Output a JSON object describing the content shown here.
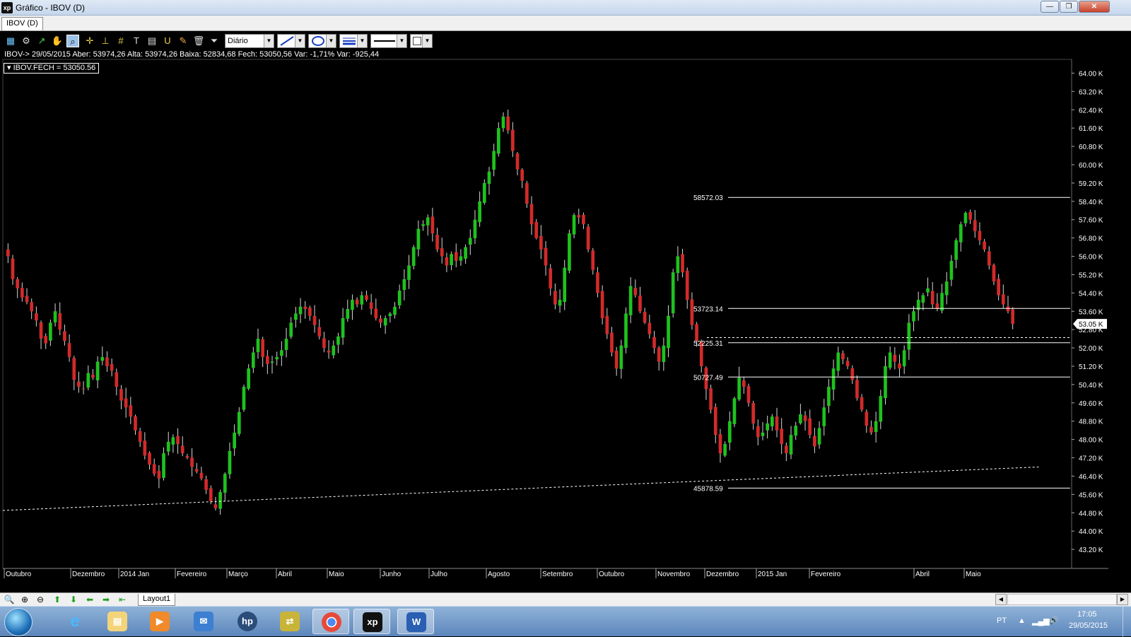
{
  "window": {
    "title": "Gráfico - IBOV (D)",
    "app_icon_text": "xp",
    "tab": "IBOV (D)",
    "controls": {
      "minimize": "—",
      "maximize": "❐",
      "close": "✕"
    }
  },
  "toolbar": {
    "icons": [
      "chart-type-icon",
      "settings-icon",
      "cursor-icon",
      "hand-icon",
      "zoom-region-icon",
      "crosshair-icon",
      "horizontal-line-icon",
      "grid-icon",
      "text-icon",
      "calculator-icon",
      "magnet-icon",
      "brush-icon",
      "trash-icon",
      "filter-icon"
    ],
    "periodicity": "Diário"
  },
  "info": {
    "line": "IBOV-> 29/05/2015 Aber: 53974,26 Alta: 53974,26 Baixa: 52834,68 Fech: 53050,56 Var: -1,71% Var: -925,44",
    "legend": "IBOV.FECH = 53050.56"
  },
  "chart_data": {
    "type": "candlestick",
    "symbol": "IBOV",
    "y_axis": {
      "min": 42400,
      "max": 64600,
      "tick_labels": [
        "64.00 K",
        "63.20 K",
        "62.40 K",
        "61.60 K",
        "60.80 K",
        "60.00 K",
        "59.20 K",
        "58.40 K",
        "57.60 K",
        "56.80 K",
        "56.00 K",
        "55.20 K",
        "54.40 K",
        "53.60 K",
        "52.80 K",
        "52.00 K",
        "51.20 K",
        "50.40 K",
        "49.60 K",
        "48.80 K",
        "48.00 K",
        "47.20 K",
        "46.40 K",
        "45.60 K",
        "44.80 K",
        "44.00 K",
        "43.20 K"
      ],
      "tick_values": [
        64000,
        63200,
        62400,
        61600,
        60800,
        60000,
        59200,
        58400,
        57600,
        56800,
        56000,
        55200,
        54400,
        53600,
        52800,
        52000,
        51200,
        50400,
        49600,
        48800,
        48000,
        47200,
        46400,
        45600,
        44800,
        44000,
        43200
      ],
      "last_price_label": "53.05 K",
      "last_price": 53050
    },
    "x_axis": {
      "labels": [
        "Outubro",
        "Dezembro",
        "2014 Jan",
        "Fevereiro",
        "Março",
        "Abril",
        "Maio",
        "Junho",
        "Julho",
        "Agosto",
        "Setembro",
        "Outubro",
        "Novembro",
        "Dezembro",
        "2015 Jan",
        "Fevereiro",
        "Abril",
        "Maio"
      ]
    },
    "horizontal_levels": [
      {
        "label": "58572.03",
        "value": 58572.03
      },
      {
        "label": "53723.14",
        "value": 53723.14
      },
      {
        "label": "52225.31",
        "value": 52225.31
      },
      {
        "label": "50727.49",
        "value": 50727.49
      },
      {
        "label": "45878.59",
        "value": 45878.59
      }
    ],
    "dashed_horizontal": 52450,
    "closes": [
      56000,
      55000,
      54600,
      54200,
      54000,
      53600,
      53200,
      52400,
      52200,
      53100,
      53600,
      52800,
      52300,
      51600,
      50600,
      50300,
      50200,
      50900,
      50700,
      51400,
      51600,
      51200,
      51000,
      50300,
      49700,
      49400,
      49000,
      48400,
      47900,
      47300,
      46900,
      46500,
      46300,
      47400,
      47900,
      48100,
      47800,
      47400,
      47200,
      46800,
      46600,
      46300,
      45800,
      45300,
      45000,
      45700,
      46500,
      47500,
      48300,
      49200,
      50300,
      51100,
      51800,
      52400,
      51600,
      51300,
      51400,
      51600,
      51900,
      52400,
      53100,
      53500,
      53800,
      53700,
      53400,
      53000,
      52500,
      52000,
      51800,
      52100,
      52500,
      53300,
      53700,
      54100,
      53900,
      54300,
      54100,
      53700,
      53300,
      53100,
      53300,
      53500,
      53800,
      54500,
      55000,
      55600,
      56400,
      57200,
      57400,
      57700,
      57000,
      56300,
      56000,
      55600,
      56100,
      55800,
      56000,
      56400,
      56800,
      57600,
      58400,
      59200,
      59700,
      60600,
      61600,
      62100,
      61500,
      60600,
      59800,
      59300,
      58300,
      57400,
      56800,
      56300,
      55600,
      54600,
      53900,
      54100,
      55500,
      57000,
      57800,
      57700,
      57400,
      56300,
      55400,
      54400,
      53300,
      52600,
      51800,
      51100,
      52100,
      53500,
      54700,
      54300,
      53600,
      53100,
      52600,
      52000,
      51400,
      52100,
      53400,
      55300,
      56000,
      55300,
      54100,
      53000,
      52300,
      51200,
      50200,
      49300,
      48200,
      47400,
      47800,
      48800,
      49800,
      50700,
      50300,
      49600,
      48700,
      48100,
      48300,
      48700,
      49000,
      48400,
      47800,
      47400,
      48200,
      48600,
      49100,
      48800,
      48200,
      47700,
      48500,
      49400,
      50300,
      51100,
      51800,
      51500,
      51200,
      50600,
      49800,
      49300,
      48600,
      48300,
      48800,
      49900,
      51200,
      51800,
      51400,
      51100,
      51900,
      53100,
      53600,
      54100,
      54300,
      54600,
      53900,
      53700,
      54400,
      54900,
      55800,
      56700,
      57400,
      57900,
      57600,
      57100,
      56700,
      56300,
      55600,
      54900,
      54300,
      53900,
      53600,
      53050
    ],
    "trendlines": [
      {
        "style": "dashed",
        "from": {
          "index": 0,
          "value": 44900
        },
        "to": {
          "index": 223,
          "value": 46800
        }
      }
    ]
  },
  "bottom": {
    "icons": [
      "zoom-icon",
      "zoom-in-icon",
      "zoom-out-icon",
      "arrow-up-icon",
      "arrow-down-icon",
      "arrow-left-icon",
      "arrow-right-icon",
      "arrow-end-icon"
    ],
    "layout_tab": "Layout1"
  },
  "taskbar": {
    "apps": [
      "internet-explorer-icon",
      "file-explorer-icon",
      "media-player-icon",
      "outlook-icon",
      "hp-icon",
      "sync-icon",
      "chrome-icon",
      "xp-app-icon",
      "word-icon"
    ],
    "xp_label": "xp",
    "language": "PT",
    "time": "17:05",
    "date": "29/05/2015"
  },
  "colors": {
    "up": "#1ec21e",
    "down": "#d22a2a",
    "line": "#ffffff",
    "background": "#000000"
  }
}
